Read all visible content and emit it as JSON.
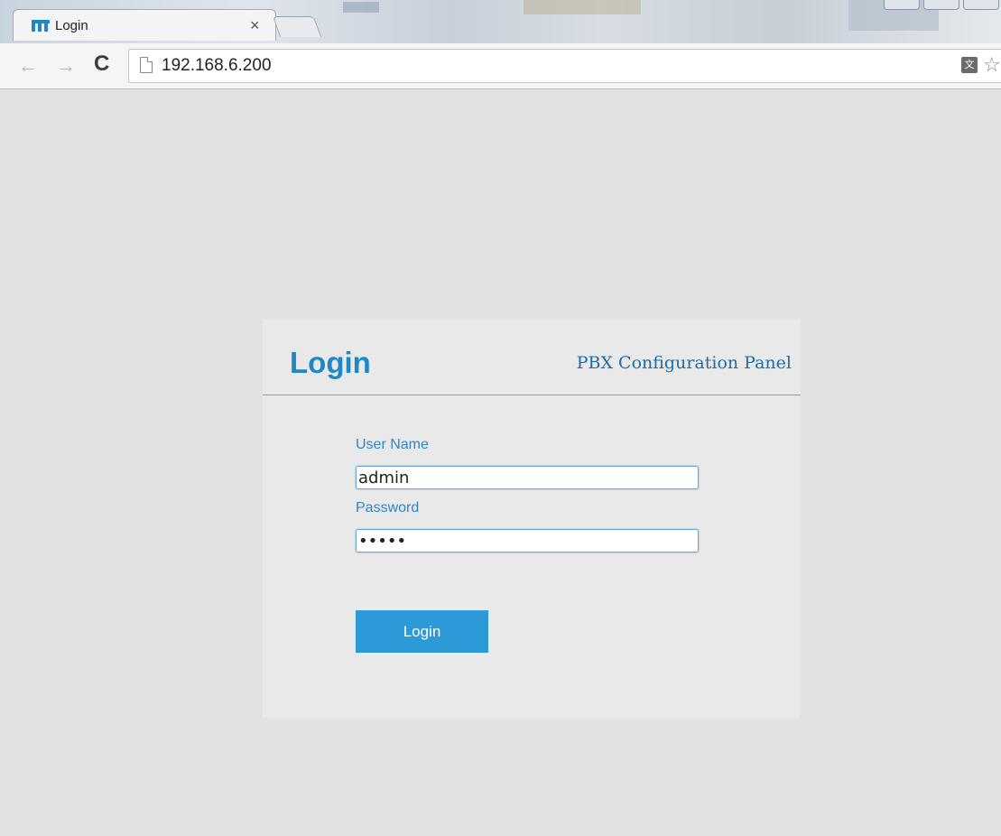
{
  "browser": {
    "tab": {
      "title": "Login",
      "close_glyph": "×",
      "icon": "site-favicon-icon"
    },
    "address_bar": {
      "url": "192.168.6.200"
    },
    "toolbar": {
      "back": "←",
      "forward": "→",
      "reload": "C",
      "star": "☆"
    }
  },
  "login_panel": {
    "title": "Login",
    "subtitle": "PBX Configuration Panel",
    "username_label": "User Name",
    "username_value": "admin",
    "password_label": "Password",
    "password_value": "•••••",
    "submit_label": "Login"
  },
  "colors": {
    "accent": "#1e88c7",
    "button": "#2d9ad8",
    "page_bg": "#e2e2e2",
    "panel_bg": "#e9e9e9"
  }
}
